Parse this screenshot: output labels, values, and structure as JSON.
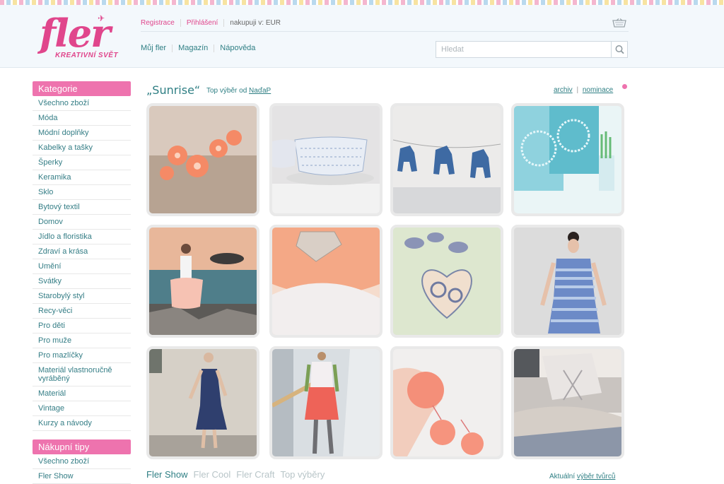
{
  "header": {
    "logo_text": "fler",
    "logo_tagline": "KREATIVNÍ SVĚT",
    "top_links": {
      "register": "Registrace",
      "login": "Přihlášení",
      "currency": "nakupuji v: EUR"
    },
    "nav": [
      "Můj fler",
      "Magazín",
      "Nápověda"
    ],
    "search_placeholder": "Hledat",
    "icons": {
      "basket": "basket-icon",
      "search": "search-icon"
    }
  },
  "sidebar": {
    "categories_title": "Kategorie",
    "categories": [
      "Všechno zboží",
      "Móda",
      "Módní doplňky",
      "Kabelky a tašky",
      "Šperky",
      "Keramika",
      "Sklo",
      "Bytový textil",
      "Domov",
      "Jídlo a floristika",
      "Zdraví a krása",
      "Umění",
      "Svátky",
      "Starobylý styl",
      "Recy-věci",
      "Pro děti",
      "Pro muže",
      "Pro mazlíčky",
      "Materiál vlastnoručně vyráběný",
      "Materiál",
      "Vintage",
      "Kurzy a návody"
    ],
    "tips_title": "Nákupní tipy",
    "tips": [
      "Všechno zboží",
      "Fler Show"
    ]
  },
  "main": {
    "title": "„Sunrise“",
    "subtitle_prefix": "Top výběr od",
    "subtitle_author": "NaďaP",
    "archive": "archiv",
    "nominate": "nominace",
    "tiles": [
      {
        "name": "product-peach-flower-bracelet"
      },
      {
        "name": "product-ceramic-cups"
      },
      {
        "name": "product-blue-horse-garland"
      },
      {
        "name": "product-blue-lace-pillows"
      },
      {
        "name": "product-tulle-skirt-girl"
      },
      {
        "name": "product-peach-scarf-brooch"
      },
      {
        "name": "product-heart-ornament"
      },
      {
        "name": "product-striped-blue-dress"
      },
      {
        "name": "product-navy-summer-dress"
      },
      {
        "name": "product-coral-skirt-outfit"
      },
      {
        "name": "product-coral-pompoms"
      },
      {
        "name": "product-grey-pillows"
      }
    ]
  },
  "bottom": {
    "tabs": [
      "Fler Show",
      "Fler Cool",
      "Fler Craft",
      "Top výběry"
    ],
    "active_tab": "Fler Show",
    "current_prefix": "Aktuální",
    "current_link": "výběr tvůrců"
  },
  "colors": {
    "brand_pink": "#e0468c",
    "teal_text": "#2f7f84",
    "side_head": "#ee73ae"
  }
}
